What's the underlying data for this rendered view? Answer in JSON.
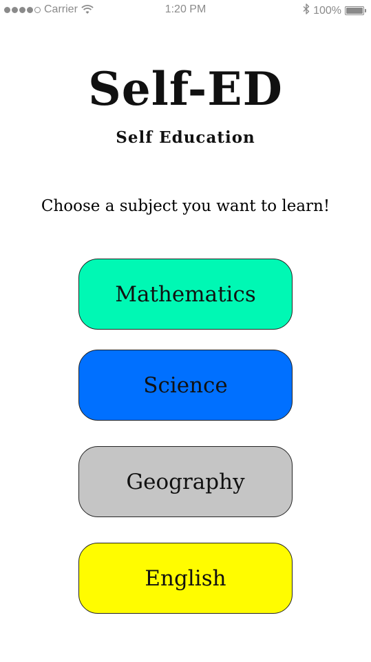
{
  "status_bar": {
    "carrier": "Carrier",
    "time": "1:20 PM",
    "battery_percent": "100%",
    "signal_bars_filled": 4,
    "signal_bars_total": 5
  },
  "app": {
    "title": "Self-ED",
    "subtitle": "Self Education"
  },
  "prompt": "Choose  a subject you want to learn!",
  "subjects": [
    {
      "label": "Mathematics",
      "color": "#00f8b4"
    },
    {
      "label": "Science",
      "color": "#0070ff"
    },
    {
      "label": "Geography",
      "color": "#c5c5c5"
    },
    {
      "label": "English",
      "color": "#fffc00"
    }
  ]
}
